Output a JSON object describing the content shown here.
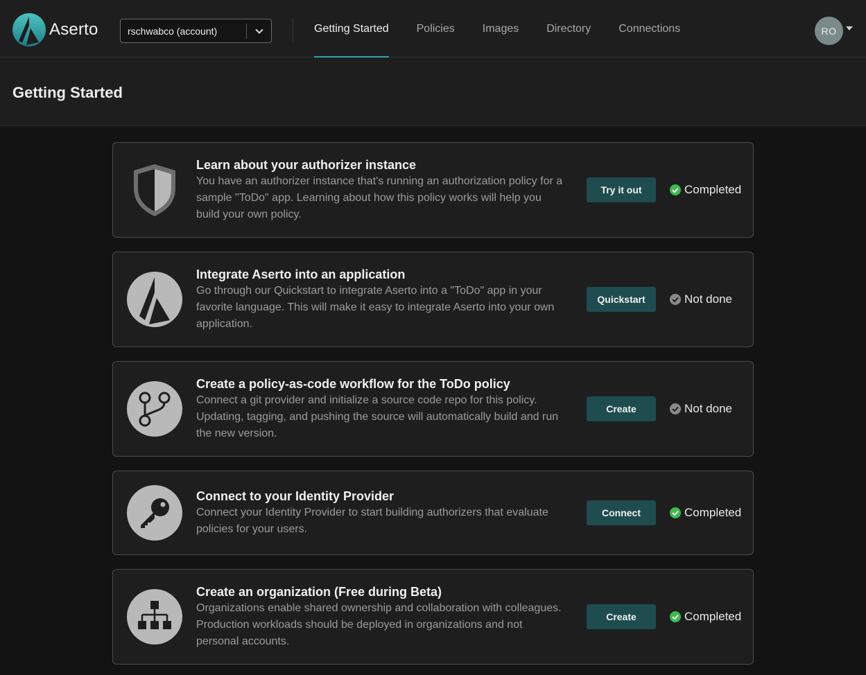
{
  "brand": {
    "name": "Aserto",
    "accent": "#2aa7a5"
  },
  "account": {
    "selected": "rschwabco (account)"
  },
  "nav": {
    "tabs": [
      {
        "label": "Getting Started",
        "active": true
      },
      {
        "label": "Policies"
      },
      {
        "label": "Images"
      },
      {
        "label": "Directory"
      },
      {
        "label": "Connections"
      }
    ]
  },
  "user": {
    "initials": "RO"
  },
  "page": {
    "title": "Getting Started"
  },
  "cards": [
    {
      "icon": "shield-icon",
      "title": "Learn about your authorizer instance",
      "description": "You have an authorizer instance that's running an authorization policy for a sample \"ToDo\" app. Learning about how this policy works will help you build your own policy.",
      "button": "Try it out",
      "status": "Completed",
      "status_color": "#3fb950"
    },
    {
      "icon": "aserto-logo-icon",
      "title": "Integrate Aserto into an application",
      "description": "Go through our Quickstart to integrate Aserto into a \"ToDo\" app in your favorite language. This will make it easy to integrate Aserto into your own application.",
      "button": "Quickstart",
      "status": "Not done",
      "status_color": "#8a8a8a"
    },
    {
      "icon": "git-branch-icon",
      "title": "Create a policy-as-code workflow for the ToDo policy",
      "description": "Connect a git provider and initialize a source code repo for this policy. Updating, tagging, and pushing the source will automatically build and run the new version.",
      "button": "Create",
      "status": "Not done",
      "status_color": "#8a8a8a"
    },
    {
      "icon": "key-icon",
      "title": "Connect to your Identity Provider",
      "description": "Connect your Identity Provider to start building authorizers that evaluate policies for your users.",
      "button": "Connect",
      "status": "Completed",
      "status_color": "#3fb950"
    },
    {
      "icon": "org-chart-icon",
      "title": "Create an organization (Free during Beta)",
      "description": "Organizations enable shared ownership and collaboration with colleagues. Production workloads should be deployed in organizations and not personal accounts.",
      "button": "Create",
      "status": "Completed",
      "status_color": "#3fb950"
    }
  ]
}
